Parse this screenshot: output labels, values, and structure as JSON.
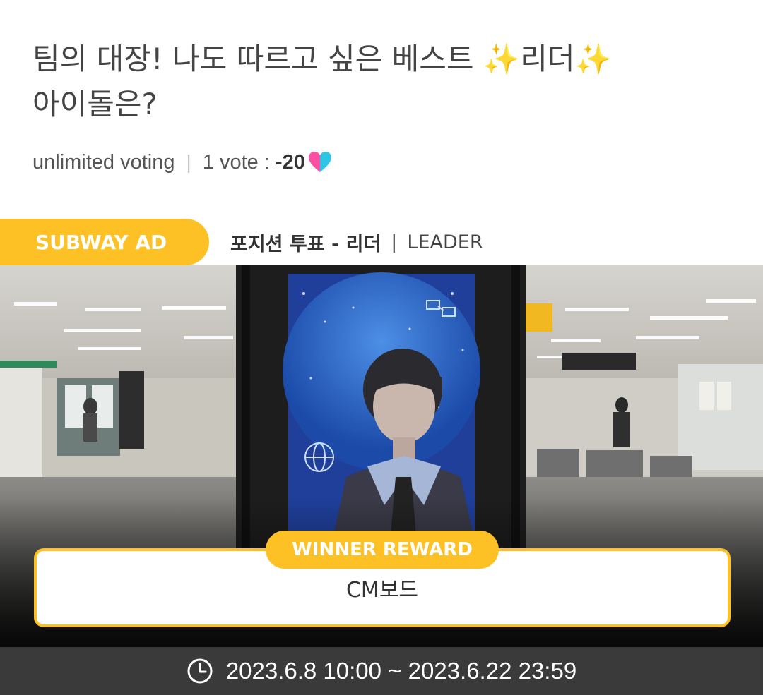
{
  "poll": {
    "title_part1": "팀의 대장! 나도 따르고 싶은 베스트 ",
    "sparkle": "✨",
    "title_part2": "리더",
    "title_line2": "아이돌은?",
    "voting_type": "unlimited voting",
    "separator": "|",
    "vote_label": "1 vote :",
    "vote_cost": "-20",
    "cost_icon": "heart-icon"
  },
  "ad": {
    "tag": "SUBWAY AD",
    "position_label": "포지션 투표 - 리더",
    "divider": "|",
    "leader_label": "LEADER",
    "reward_tag": "WINNER REWARD",
    "reward_value": "CM보드"
  },
  "period": {
    "icon": "clock-icon",
    "text": "2023.6.8 10:00 ~ 2023.6.22 23:59"
  },
  "colors": {
    "accent": "#fdc126",
    "date_bar": "#3a3a3a"
  }
}
